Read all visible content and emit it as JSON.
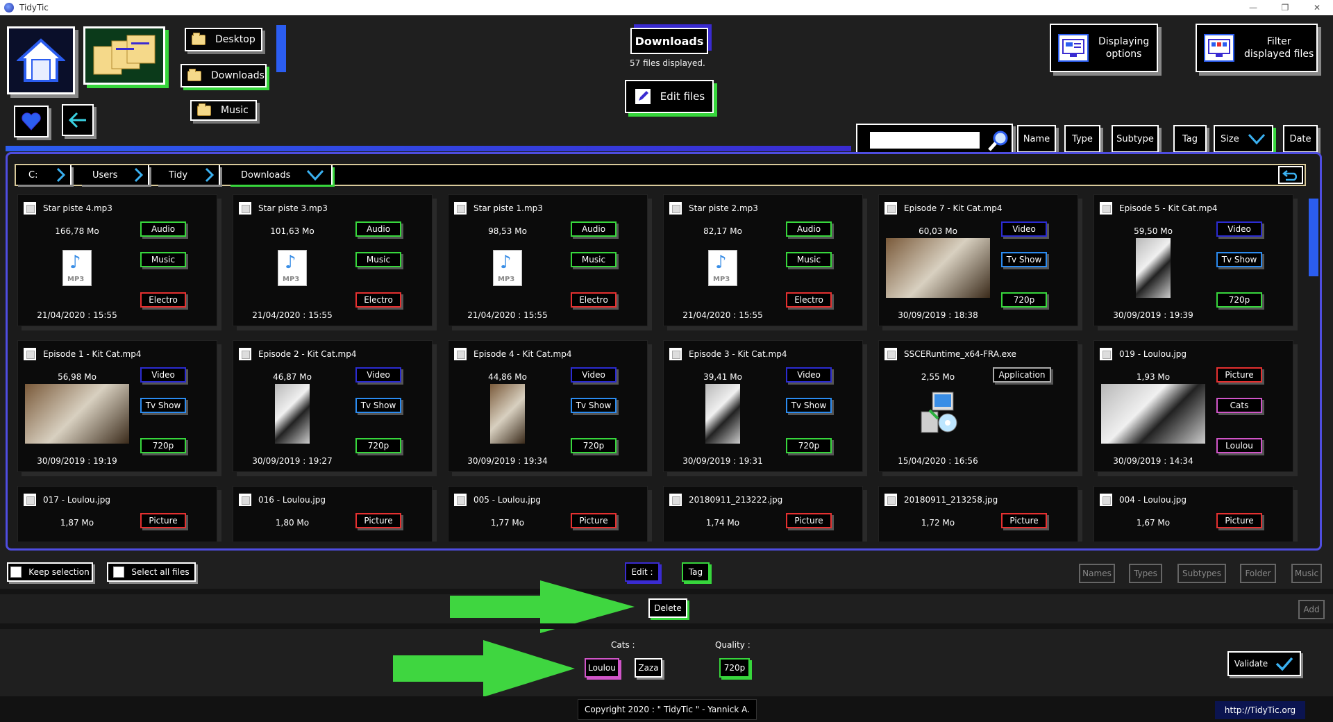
{
  "window": {
    "title": "TidyTic",
    "min": "—",
    "restore": "❐",
    "close": "✕"
  },
  "quick_folders": [
    {
      "label": "Desktop"
    },
    {
      "label": "Downloads"
    },
    {
      "label": "Music"
    }
  ],
  "current_folder": {
    "title": "Downloads",
    "count_text": "57 files displayed.",
    "edit_label": "Edit files"
  },
  "top_options": {
    "displaying_line1": "Displaying",
    "displaying_line2": "options",
    "filter_line1": "Filter",
    "filter_line2": "displayed files"
  },
  "sort_buttons": [
    "Name",
    "Type",
    "Subtype",
    "Tag",
    "Size",
    "Date"
  ],
  "breadcrumb": [
    "C:",
    "Users",
    "Tidy",
    "Downloads"
  ],
  "files": [
    {
      "name": "Star piste 4.mp3",
      "size": "166,78 Mo",
      "date": "21/04/2020 : 15:55",
      "thumb": "mp3",
      "tags": [
        "Audio",
        "Music",
        "Electro"
      ]
    },
    {
      "name": "Star piste 3.mp3",
      "size": "101,63 Mo",
      "date": "21/04/2020 : 15:55",
      "thumb": "mp3",
      "tags": [
        "Audio",
        "Music",
        "Electro"
      ]
    },
    {
      "name": "Star piste 1.mp3",
      "size": "98,53 Mo",
      "date": "21/04/2020 : 15:55",
      "thumb": "mp3",
      "tags": [
        "Audio",
        "Music",
        "Electro"
      ]
    },
    {
      "name": "Star piste 2.mp3",
      "size": "82,17 Mo",
      "date": "21/04/2020 : 15:55",
      "thumb": "mp3",
      "tags": [
        "Audio",
        "Music",
        "Electro"
      ]
    },
    {
      "name": "Episode 7 - Kit Cat.mp4",
      "size": "60,03 Mo",
      "date": "30/09/2019 : 18:38",
      "thumb": "photo",
      "tags": [
        "Video",
        "Tv Show",
        "720p"
      ]
    },
    {
      "name": "Episode 5 - Kit Cat.mp4",
      "size": "59,50 Mo",
      "date": "30/09/2019 : 19:39",
      "thumb": "photo",
      "tags": [
        "Video",
        "Tv Show",
        "720p"
      ]
    },
    {
      "name": "Episode 1 - Kit Cat.mp4",
      "size": "56,98 Mo",
      "date": "30/09/2019 : 19:19",
      "thumb": "photo",
      "tags": [
        "Video",
        "Tv Show",
        "720p"
      ]
    },
    {
      "name": "Episode 2 - Kit Cat.mp4",
      "size": "46,87 Mo",
      "date": "30/09/2019 : 19:27",
      "thumb": "photo",
      "tags": [
        "Video",
        "Tv Show",
        "720p"
      ]
    },
    {
      "name": "Episode 4 - Kit Cat.mp4",
      "size": "44,86 Mo",
      "date": "30/09/2019 : 19:34",
      "thumb": "photo",
      "tags": [
        "Video",
        "Tv Show",
        "720p"
      ]
    },
    {
      "name": "Episode 3 - Kit Cat.mp4",
      "size": "39,41 Mo",
      "date": "30/09/2019 : 19:31",
      "thumb": "photo",
      "tags": [
        "Video",
        "Tv Show",
        "720p"
      ]
    },
    {
      "name": "SSCERuntime_x64-FRA.exe",
      "size": "2,55 Mo",
      "date": "15/04/2020 : 16:56",
      "thumb": "exe",
      "tags": [
        "Application"
      ]
    },
    {
      "name": "019 - Loulou.jpg",
      "size": "1,93 Mo",
      "date": "30/09/2019 : 14:34",
      "thumb": "photo",
      "tags": [
        "Picture",
        "Cats",
        "Loulou"
      ]
    },
    {
      "name": "017 - Loulou.jpg",
      "size": "1,87 Mo",
      "date": "",
      "thumb": "none",
      "tags": [
        "Picture"
      ]
    },
    {
      "name": "016 - Loulou.jpg",
      "size": "1,80 Mo",
      "date": "",
      "thumb": "none",
      "tags": [
        "Picture"
      ]
    },
    {
      "name": "005 - Loulou.jpg",
      "size": "1,77 Mo",
      "date": "",
      "thumb": "none",
      "tags": [
        "Picture"
      ]
    },
    {
      "name": "20180911_213222.jpg",
      "size": "1,74 Mo",
      "date": "",
      "thumb": "none",
      "tags": [
        "Picture"
      ]
    },
    {
      "name": "20180911_213258.jpg",
      "size": "1,72 Mo",
      "date": "",
      "thumb": "none",
      "tags": [
        "Picture"
      ]
    },
    {
      "name": "004 - Loulou.jpg",
      "size": "1,67 Mo",
      "date": "",
      "thumb": "none",
      "tags": [
        "Picture"
      ]
    }
  ],
  "bottom": {
    "keep_selection": "Keep selection",
    "select_all": "Select all files",
    "edit": "Edit :",
    "tag": "Tag",
    "right_buttons": [
      "Names",
      "Types",
      "Subtypes",
      "Folder",
      "Music"
    ],
    "delete": "Delete",
    "add": "Add",
    "cats_label": "Cats :",
    "cats_options": [
      "Loulou",
      "Zaza"
    ],
    "quality_label": "Quality :",
    "quality_option": "720p",
    "validate": "Validate"
  },
  "footer": {
    "copyright": "Copyright 2020 : \" TidyTic \" - Yannick A.",
    "link": "http://TidyTic.org"
  },
  "colors": {
    "accent_blue": "#2b5df0",
    "accent_purple": "#4f4de0",
    "accent_green": "#37d63c",
    "tag_red": "#e53030"
  }
}
